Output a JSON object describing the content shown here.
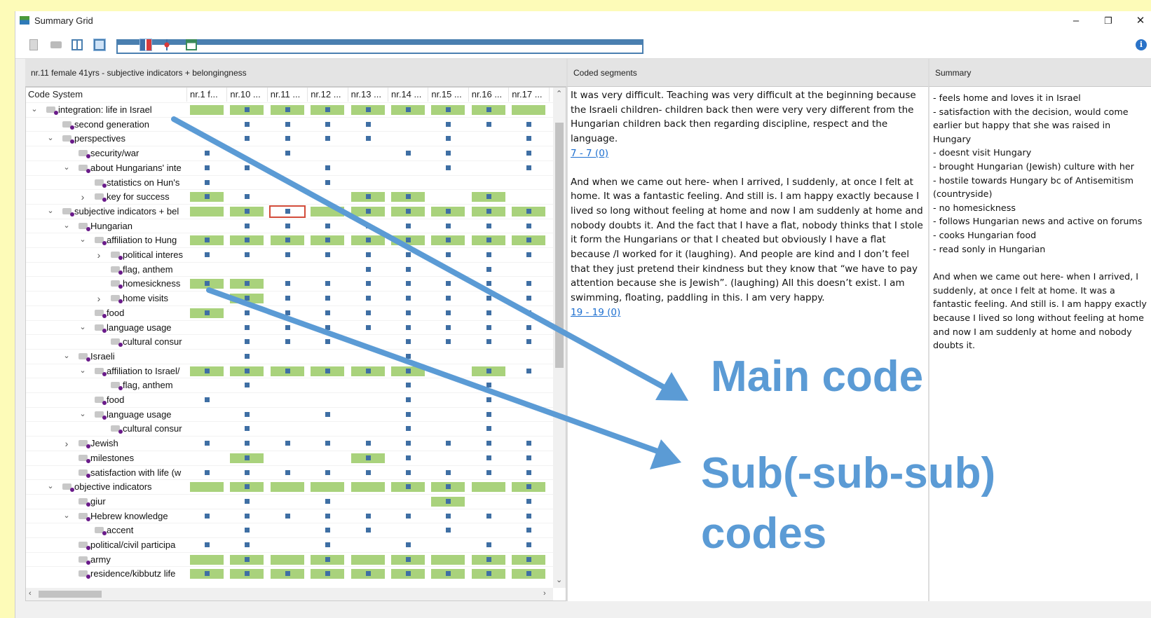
{
  "window": {
    "title": "Summary Grid",
    "minimize": "–",
    "restore": "❐",
    "close": "✕"
  },
  "toolbar": {
    "info": "i"
  },
  "left_header": "nr.11 female 41yrs - subjective indicators + belongingness",
  "mid_header": "Coded segments",
  "right_header": "Summary",
  "grid": {
    "code_system_label": "Code System",
    "columns": [
      "nr.1 f...",
      "nr.10 ...",
      "nr.11 ...",
      "nr.12 ...",
      "nr.13 ...",
      "nr.14 ...",
      "nr.15 ...",
      "nr.16 ...",
      "nr.17 ..."
    ],
    "selected": {
      "row": 7,
      "col": 2
    },
    "rows": [
      {
        "label": "integration: life in Israel",
        "level": 0,
        "expand": "open",
        "green": [
          0,
          1,
          2,
          3,
          4,
          5,
          6,
          7,
          8
        ],
        "squares": [
          1,
          2,
          3,
          4,
          5,
          6,
          7
        ]
      },
      {
        "label": "second generation",
        "level": 1,
        "expand": "",
        "green": [],
        "squares": [
          1,
          2,
          3,
          4,
          6,
          7,
          8
        ]
      },
      {
        "label": "perspectives",
        "level": 1,
        "expand": "open",
        "green": [],
        "squares": [
          1,
          2,
          3,
          4,
          6,
          8
        ]
      },
      {
        "label": "security/war",
        "level": 2,
        "expand": "",
        "green": [],
        "squares": [
          0,
          2,
          5,
          6,
          8
        ]
      },
      {
        "label": "about Hungarians' inte",
        "level": 2,
        "expand": "open",
        "green": [],
        "squares": [
          0,
          1,
          3,
          6,
          8
        ]
      },
      {
        "label": "statistics on Hun's",
        "level": 3,
        "expand": "",
        "green": [],
        "squares": [
          0,
          3
        ]
      },
      {
        "label": "key for success",
        "level": 3,
        "expand": "closed",
        "green": [
          0,
          4,
          5,
          7
        ],
        "squares": [
          0,
          1,
          4,
          5,
          7
        ]
      },
      {
        "label": "subjective indicators + bel",
        "level": 1,
        "expand": "open",
        "green": [
          0,
          1,
          3,
          4,
          5,
          6,
          7,
          8
        ],
        "squares": [
          1,
          2,
          4,
          5,
          6,
          7,
          8
        ]
      },
      {
        "label": "Hungarian",
        "level": 2,
        "expand": "open",
        "green": [],
        "squares": [
          1,
          2,
          3,
          4,
          5,
          6,
          7,
          8
        ]
      },
      {
        "label": "affiliation to Hung",
        "level": 3,
        "expand": "open",
        "green": [
          0,
          1,
          2,
          3,
          4,
          5,
          6,
          7,
          8
        ],
        "squares": [
          0,
          1,
          2,
          3,
          4,
          5,
          6,
          7,
          8
        ]
      },
      {
        "label": "political interes",
        "level": 4,
        "expand": "closed",
        "green": [],
        "squares": [
          0,
          1,
          2,
          3,
          4,
          5,
          6,
          7,
          8
        ]
      },
      {
        "label": "flag, anthem",
        "level": 4,
        "expand": "",
        "green": [],
        "squares": [
          4,
          5,
          7
        ]
      },
      {
        "label": "homesickness",
        "level": 4,
        "expand": "",
        "green": [
          0,
          1
        ],
        "squares": [
          0,
          1,
          2,
          3,
          4,
          5,
          6,
          7,
          8
        ]
      },
      {
        "label": "home visits",
        "level": 4,
        "expand": "closed",
        "green": [
          1
        ],
        "squares": [
          1,
          2,
          3,
          4,
          5,
          6,
          7,
          8
        ]
      },
      {
        "label": "food",
        "level": 3,
        "expand": "",
        "green": [
          0
        ],
        "squares": [
          0,
          1,
          2,
          3,
          4,
          5,
          6,
          7,
          8
        ]
      },
      {
        "label": "language usage",
        "level": 3,
        "expand": "open",
        "green": [],
        "squares": [
          1,
          2,
          3,
          4,
          5,
          6,
          7,
          8
        ]
      },
      {
        "label": "cultural consur",
        "level": 4,
        "expand": "",
        "green": [],
        "squares": [
          1,
          2,
          3,
          5,
          6,
          7,
          8
        ]
      },
      {
        "label": "Israeli",
        "level": 2,
        "expand": "open",
        "green": [],
        "squares": [
          1,
          5
        ]
      },
      {
        "label": "affiliation to Israel/",
        "level": 3,
        "expand": "open",
        "green": [
          0,
          1,
          2,
          3,
          4,
          5,
          7
        ],
        "squares": [
          0,
          1,
          2,
          3,
          4,
          5,
          7,
          8
        ]
      },
      {
        "label": "flag, anthem",
        "level": 4,
        "expand": "",
        "green": [],
        "squares": [
          1,
          5,
          7
        ]
      },
      {
        "label": "food",
        "level": 3,
        "expand": "",
        "green": [],
        "squares": [
          0,
          5,
          7
        ]
      },
      {
        "label": "language usage",
        "level": 3,
        "expand": "open",
        "green": [],
        "squares": [
          1,
          3,
          5,
          7
        ]
      },
      {
        "label": "cultural consur",
        "level": 4,
        "expand": "",
        "green": [],
        "squares": [
          1,
          5,
          7
        ]
      },
      {
        "label": "Jewish",
        "level": 2,
        "expand": "closed",
        "green": [],
        "squares": [
          0,
          1,
          2,
          3,
          4,
          5,
          6,
          7,
          8
        ]
      },
      {
        "label": "milestones",
        "level": 2,
        "expand": "",
        "green": [
          1,
          4
        ],
        "squares": [
          1,
          4,
          5,
          7,
          8
        ]
      },
      {
        "label": "satisfaction with life (w",
        "level": 2,
        "expand": "",
        "green": [],
        "squares": [
          0,
          1,
          2,
          3,
          4,
          5,
          6,
          7,
          8
        ]
      },
      {
        "label": "objective indicators",
        "level": 1,
        "expand": "open",
        "green": [
          0,
          1,
          2,
          3,
          4,
          5,
          6,
          7,
          8
        ],
        "squares": [
          1,
          5,
          6,
          8
        ]
      },
      {
        "label": "giur",
        "level": 2,
        "expand": "",
        "green": [
          6
        ],
        "squares": [
          1,
          3,
          6,
          8
        ]
      },
      {
        "label": "Hebrew knowledge",
        "level": 2,
        "expand": "open",
        "green": [],
        "squares": [
          0,
          1,
          2,
          3,
          4,
          5,
          6,
          7,
          8
        ]
      },
      {
        "label": "accent",
        "level": 3,
        "expand": "",
        "green": [],
        "squares": [
          1,
          3,
          4,
          6,
          8
        ]
      },
      {
        "label": "political/civil participa",
        "level": 2,
        "expand": "",
        "green": [],
        "squares": [
          0,
          1,
          3,
          5,
          7,
          8
        ]
      },
      {
        "label": "army",
        "level": 2,
        "expand": "",
        "green": [
          0,
          1,
          2,
          3,
          4,
          5,
          6,
          7,
          8
        ],
        "squares": [
          1,
          3,
          5,
          7,
          8
        ]
      },
      {
        "label": "residence/kibbutz life",
        "level": 2,
        "expand": "",
        "green": [
          0,
          1,
          2,
          3,
          4,
          5,
          6,
          7,
          8
        ],
        "squares": [
          0,
          1,
          2,
          3,
          4,
          5,
          6,
          7,
          8
        ]
      }
    ]
  },
  "segments": [
    {
      "text": "It was very difficult. Teaching was very difficult at the beginning because the Israeli children- children back then were very very different from the Hungarian children back then regarding discipline, respect and the language.",
      "link": "7 - 7 (0)"
    },
    {
      "text": "And when we came out here- when I arrived, I suddenly, at once I felt at home. It was a fantastic feeling. And still is. I am happy exactly because I lived so long without feeling at home and now I am suddenly at home and nobody doubts it. And the fact that I have a flat, nobody thinks that I stole it form the Hungarians or that I cheated but obviously I have a flat because /I worked for it (laughing). And people are kind and I don’t feel that they just pretend their kindness but they know that “we have to pay attention because she is Jewish”. (laughing) All this doesn’t exist. I am swimming, floating, paddling in this. I am very happy.",
      "link": "19 - 19 (0)"
    }
  ],
  "summary": {
    "bullets": "- feels home and loves it in Israel\n- satisfaction with the decision, would come earlier but happy that she was raised in Hungary\n- doesnt visit Hungary\n- brought Hungarian (Jewish) culture with her\n- hostile towards Hungary bc of Antisemitism (countryside)\n- no homesickness\n- follows Hungarian news and active on forums\n- cooks Hungarian food\n- read sonly in Hungarian",
    "paragraph": "And when we came out here- when I arrived, I suddenly, at once I felt at home. It was a fantastic feeling. And still is. I am happy exactly because I lived so long without feeling at home and now I am suddenly at home and nobody doubts it."
  },
  "annotations": {
    "main_code": "Main code",
    "sub_codes_line1": "Sub(-sub-sub)",
    "sub_codes_line2": "codes",
    "arrow_color": "#5b9bd5"
  }
}
